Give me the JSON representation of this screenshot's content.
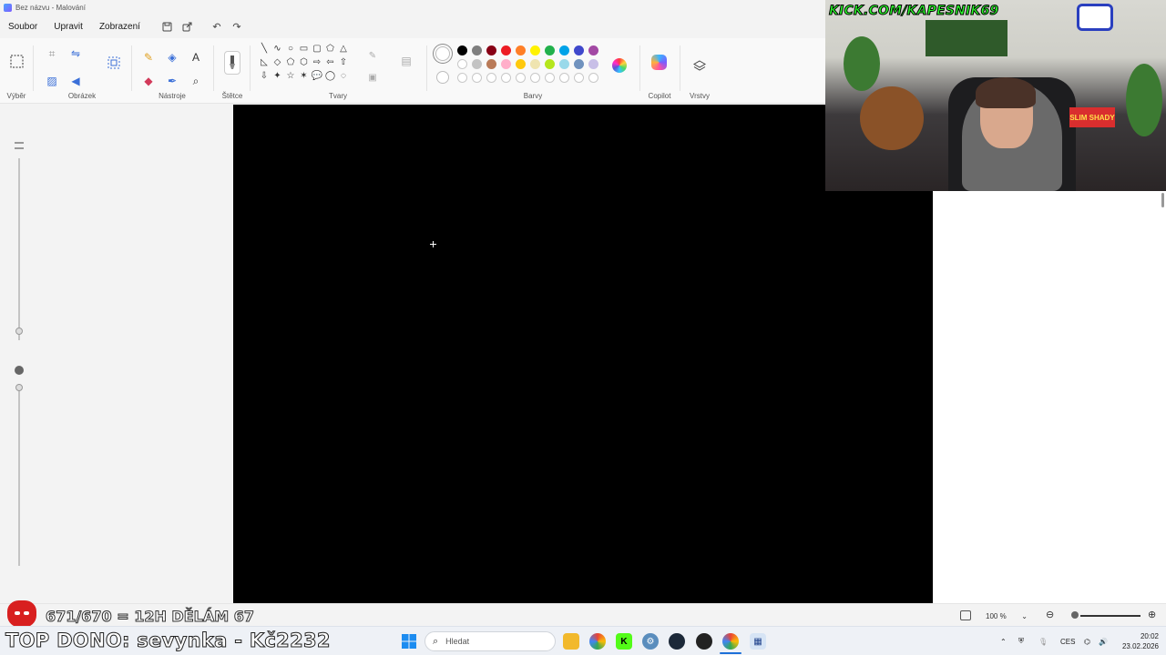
{
  "window": {
    "title": "Bez názvu - Malování"
  },
  "menu": {
    "file": "Soubor",
    "edit": "Upravit",
    "view": "Zobrazení",
    "icons": [
      "save-icon",
      "share-icon",
      "undo-icon",
      "redo-icon"
    ]
  },
  "ribbon": {
    "selection_label": "Výběr",
    "image_label": "Obrázek",
    "tools_label": "Nástroje",
    "brushes_label": "Štětce",
    "shapes_label": "Tvary",
    "colors_label": "Barvy",
    "copilot_label": "Copilot",
    "layers_label": "Vrstvy",
    "text_tool_glyph": "A",
    "shapes": [
      "╲",
      "∿",
      "○",
      "▭",
      "▢",
      "⬠",
      "△",
      "◺",
      "◇",
      "⬠",
      "⬡",
      "⇨",
      "⇦",
      "⇧",
      "⇩",
      "✦",
      "☆",
      "✶",
      "💬",
      "◯",
      "◌"
    ],
    "colors_row1": [
      "#000000",
      "#7f7f7f",
      "#880015",
      "#ed1c24",
      "#ff7f27",
      "#fff200",
      "#22b14c",
      "#00a2e8",
      "#3f48cc",
      "#a349a4"
    ],
    "colors_row2": [
      "#ffffff",
      "#c3c3c3",
      "#b97a57",
      "#ffaec9",
      "#ffc90e",
      "#efe4b0",
      "#b5e61d",
      "#99d9ea",
      "#7092be",
      "#c8bfe7"
    ]
  },
  "canvas": {
    "background": "#000000"
  },
  "webcam": {
    "overlay_text": "KICK.COM/KAPESNIK69",
    "sign_text": "SLIM SHADY"
  },
  "status": {
    "zoom": "100 %",
    "subs_counter": "671/670 = 12H DĚLÁM 67",
    "top_donor": "TOP DONO: sevynka - Kč2232"
  },
  "taskbar": {
    "search_placeholder": "Hledat",
    "language": "CES",
    "time": "20:02",
    "date": "23.02.2026"
  }
}
